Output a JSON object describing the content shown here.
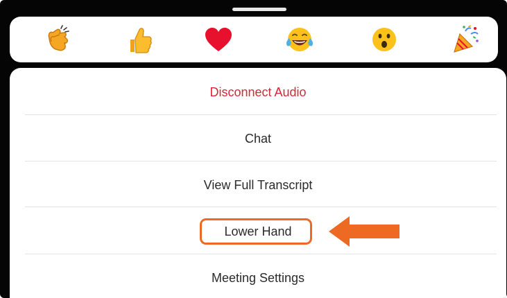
{
  "reactions": [
    {
      "icon": "clapping-hands-icon"
    },
    {
      "icon": "thumbs-up-icon"
    },
    {
      "icon": "red-heart-icon"
    },
    {
      "icon": "tears-of-joy-icon"
    },
    {
      "icon": "open-mouth-icon"
    },
    {
      "icon": "party-popper-icon"
    }
  ],
  "menu": {
    "disconnect_audio": "Disconnect Audio",
    "chat": "Chat",
    "view_full_transcript": "View Full Transcript",
    "lower_hand": "Lower Hand",
    "meeting_settings": "Meeting Settings"
  },
  "colors": {
    "danger": "#d62738",
    "highlight": "#ee6a22",
    "background": "#050505"
  },
  "annotation": {
    "highlighted_item": "Lower Hand",
    "arrow_icon": "orange-left-arrow-icon"
  }
}
